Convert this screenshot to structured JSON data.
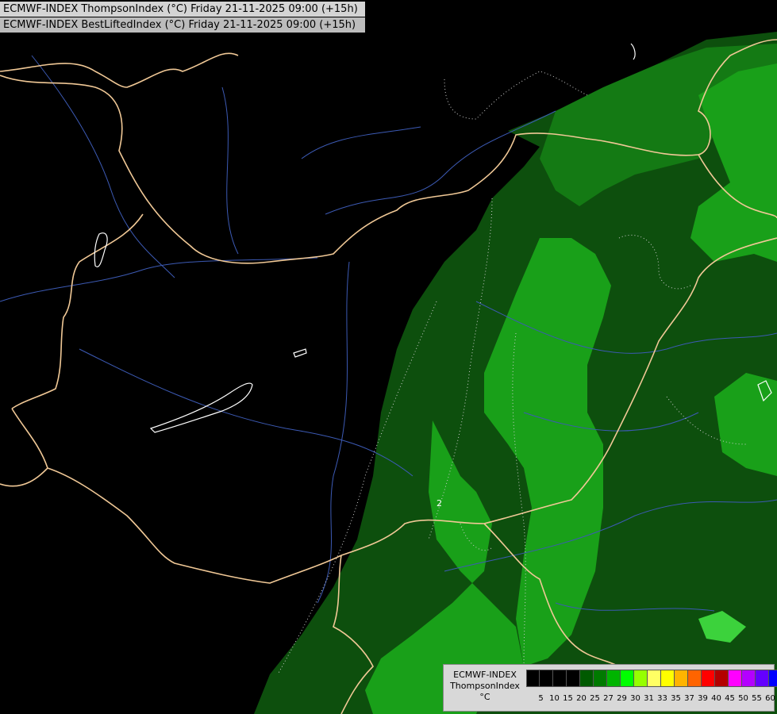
{
  "titles": [
    "ECMWF-INDEX ThompsonIndex (°C) Friday 21-11-2025 09:00 (+15h)",
    "ECMWF-INDEX BestLiftedIndex (°C) Friday 21-11-2025 09:00 (+15h)"
  ],
  "legend": {
    "line1": "ECMWF-INDEX",
    "line2": "ThompsonIndex",
    "unit": "°C",
    "ticks": [
      "5",
      "10",
      "15",
      "20",
      "25",
      "27",
      "29",
      "30",
      "31",
      "33",
      "35",
      "37",
      "39",
      "40",
      "45",
      "50",
      "55",
      "60"
    ],
    "colors": [
      "#000000",
      "#000000",
      "#000000",
      "#000000",
      "#005a00",
      "#007a00",
      "#00b400",
      "#00ff00",
      "#96ff00",
      "#ffff64",
      "#ffff00",
      "#ffb400",
      "#ff6400",
      "#ff0000",
      "#b40000",
      "#ff00ff",
      "#b400ff",
      "#6400ff",
      "#0000ff"
    ]
  },
  "map": {
    "background": "#000000",
    "zone_colors": {
      "dark_green": "#0d4f0d",
      "mid_green": "#147a14",
      "bright_green": "#19a019",
      "light_green": "#3cd23c"
    },
    "border_color": "#f0c896",
    "river_color": "#3c5ab4",
    "contour_label": "2"
  }
}
